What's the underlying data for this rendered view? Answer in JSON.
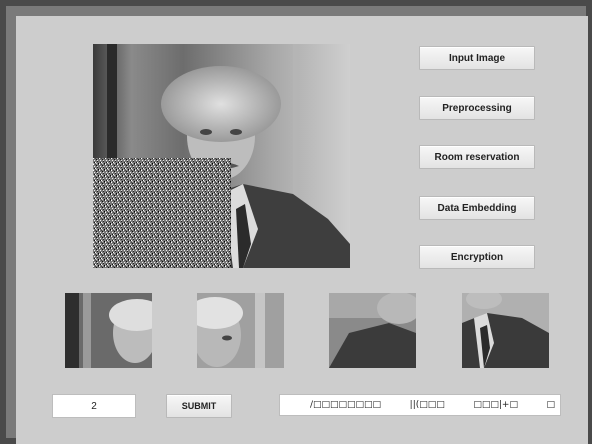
{
  "buttons": {
    "input_image": "Input Image",
    "preprocessing": "Preprocessing",
    "room_reservation": "Room reservation",
    "data_embedding": "Data Embedding",
    "encryption": "Encryption",
    "submit": "SUBMIT"
  },
  "inputs": {
    "block_value": "2",
    "output_text": "/□□□□□□□□          ||(□□□          □□□|+□          □"
  },
  "images": {
    "main": "portrait-with-noise-block",
    "tiles": [
      "tile-1",
      "tile-2",
      "tile-3",
      "tile-4"
    ]
  },
  "colors": {
    "panel": "#cdcdcd",
    "frame": "#4a4a4a",
    "button": "#efefef"
  }
}
